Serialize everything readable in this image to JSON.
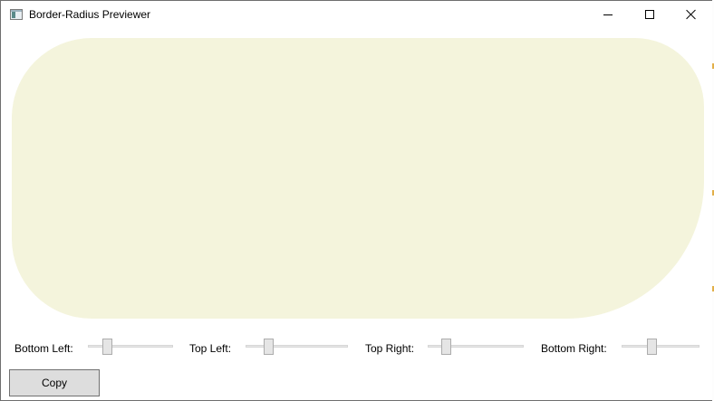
{
  "window": {
    "title": "Border-Radius Previewer",
    "icon": "app-window-icon",
    "controls": {
      "minimize": "minimize-icon",
      "maximize": "maximize-icon",
      "close": "close-icon"
    }
  },
  "preview": {
    "color": "#f4f4dc"
  },
  "sliders": [
    {
      "id": "bottom-left",
      "label": "Bottom Left:",
      "value": 0.22
    },
    {
      "id": "top-left",
      "label": "Top Left:",
      "value": 0.22
    },
    {
      "id": "top-right",
      "label": "Top Right:",
      "value": 0.19
    },
    {
      "id": "bottom-right",
      "label": "Bottom Right:",
      "value": 0.38
    }
  ],
  "actions": {
    "copy_label": "Copy"
  }
}
